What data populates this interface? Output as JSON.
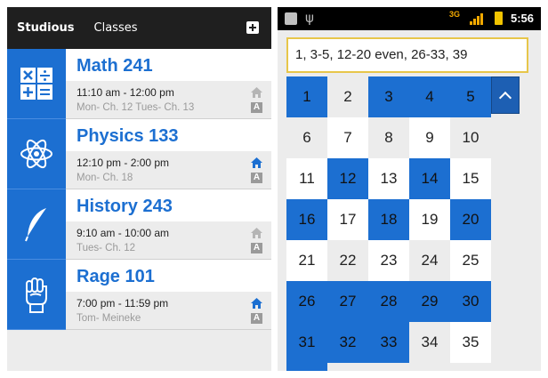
{
  "left_app": {
    "tabs": [
      "Studious",
      "Classes"
    ],
    "add_label": "",
    "classes": [
      {
        "name": "Math 241",
        "time": "11:10 am - 12:00 pm",
        "note": "Mon- Ch. 12  Tues- Ch. 13",
        "icon": "math-operators-icon",
        "home_active": false
      },
      {
        "name": "Physics 133",
        "time": "12:10 pm - 2:00 pm",
        "note": "Mon- Ch. 18",
        "icon": "atom-icon",
        "home_active": true
      },
      {
        "name": "History 243",
        "time": "9:10 am - 10:00 am",
        "note": "Tues- Ch. 12",
        "icon": "feather-quill-icon",
        "home_active": false
      },
      {
        "name": "Rage 101",
        "time": "7:00 pm - 11:59 pm",
        "note": "Tom- Meineke",
        "icon": "raised-fist-icon",
        "home_active": true
      }
    ],
    "colors": {
      "accent": "#1c6fd1",
      "topbar": "#1f1f1f",
      "panel": "#ececec"
    }
  },
  "right_app": {
    "status": {
      "network": "3G",
      "time": "5:56"
    },
    "input_value": "1, 3-5, 12-20 even, 26-33, 39",
    "numbers": [
      "1",
      "2",
      "3",
      "4",
      "5",
      "6",
      "7",
      "8",
      "9",
      "10",
      "11",
      "12",
      "13",
      "14",
      "15",
      "16",
      "17",
      "18",
      "19",
      "20",
      "21",
      "22",
      "23",
      "24",
      "25",
      "26",
      "27",
      "28",
      "29",
      "30",
      "31",
      "32",
      "33",
      "34",
      "35"
    ],
    "selected": [
      1,
      3,
      4,
      5,
      12,
      14,
      16,
      18,
      20,
      26,
      27,
      28,
      29,
      30,
      31,
      32,
      33
    ]
  }
}
